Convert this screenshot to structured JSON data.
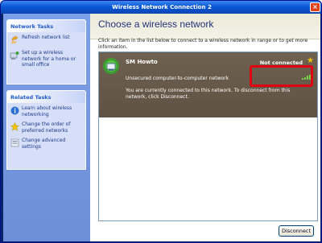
{
  "window": {
    "title": "Wireless Network Connection 2",
    "close_glyph": "×"
  },
  "sidebar": {
    "network_tasks": {
      "heading": "Network Tasks",
      "items": [
        {
          "label": "Refresh network list",
          "icon": "refresh-icon"
        },
        {
          "label": "Set up a wireless network for a home or small office",
          "icon": "setup-wireless-icon"
        }
      ]
    },
    "related_tasks": {
      "heading": "Related Tasks",
      "items": [
        {
          "label": "Learn about wireless networking",
          "icon": "info-icon"
        },
        {
          "label": "Change the order of preferred networks",
          "icon": "star-icon"
        },
        {
          "label": "Change advanced settings",
          "icon": "settings-icon"
        }
      ]
    }
  },
  "main": {
    "heading": "Choose a wireless network",
    "instructions": "Click an item in the list below to connect to a wireless network in range or to get more information.",
    "networks": [
      {
        "name": "SM Howto",
        "status": "Not connected",
        "security": "Unsecured computer-to-computer network",
        "detail": "You are currently connected to this network. To disconnect from this network, click Disconnect.",
        "signal_bars": 5
      }
    ],
    "action_button": "Disconnect"
  },
  "colors": {
    "highlight": "#e00010",
    "selected_row": "#6b5c4a",
    "title_link": "#215dc6"
  }
}
